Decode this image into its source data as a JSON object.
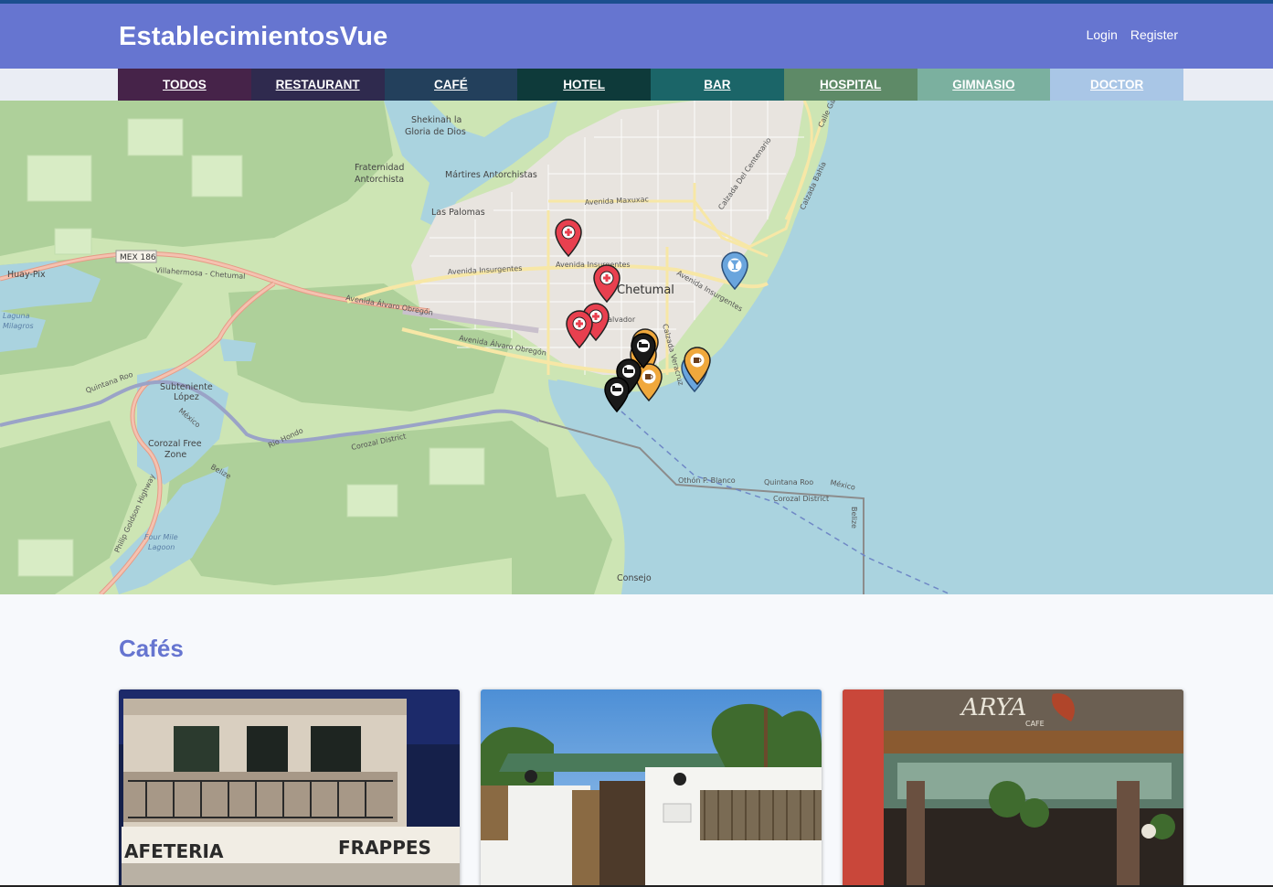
{
  "header": {
    "brand": "EstablecimientosVue",
    "login_label": "Login",
    "register_label": "Register",
    "bg_color": "#6675d0"
  },
  "nav": {
    "items": [
      {
        "label": "TODOS",
        "color": "#462349"
      },
      {
        "label": "RESTAURANT",
        "color": "#2f2a4e"
      },
      {
        "label": "CAFÉ",
        "color": "#23405c"
      },
      {
        "label": "HOTEL",
        "color": "#0e3a3a"
      },
      {
        "label": "BAR",
        "color": "#1b6568"
      },
      {
        "label": "HOSPITAL",
        "color": "#5e8a67"
      },
      {
        "label": "GIMNASIO",
        "color": "#7bb09f"
      },
      {
        "label": "DOCTOR",
        "color": "#a9c6e6"
      }
    ]
  },
  "map": {
    "labels": {
      "shekinah_1": "Shekinah la",
      "shekinah_2": "Gloria de Dios",
      "fraternidad_1": "Fraternidad",
      "fraternidad_2": "Antorchista",
      "martires": "Mártires Antorchistas",
      "palomas": "Las Palomas",
      "huay_pix": "Huay-Pix",
      "mex186": "MEX 186",
      "villahermosa": "Villahermosa - Chetumal",
      "av_maxuxac": "Avenida Maxuxac",
      "av_insurgentes": "Avenida Insurgentes",
      "av_insurgentes_e": "Avenida Insurgentes",
      "av_obregon": "Avenida Álvaro Obregón",
      "av_obregon_2": "Avenida Álvaro Obregón",
      "chetumal": "Chetumal",
      "salvador": "Salvador",
      "calzada_bahia": "Calzada Bahía",
      "calzada_cementerio": "Calzada Del Centenario",
      "calzada_veracruz": "Calzada Veracruz",
      "laguna_1": "Laguna",
      "laguna_2": "Milagros",
      "quintana_roo": "Quintana Roo",
      "subteniente_1": "Subteniente",
      "subteniente_2": "López",
      "corozal_1": "Corozal Free",
      "corozal_2": "Zone",
      "mexico": "México",
      "corozal_district": "Corozal District",
      "corozal_district_2": "Corozal District",
      "belize": "Belize",
      "belize_2": "Belize",
      "othon": "Othón P. Blanco",
      "quintana_roo_2": "Quintana Roo",
      "mexico_2": "México",
      "four_mile_1": "Four Mile",
      "four_mile_2": "Lagoon",
      "philip": "Philip Goldson Highway",
      "consejo": "Consejo",
      "rio_hondo": "Río Hondo",
      "calle_gaza": "Calle Gaza"
    },
    "markers": [
      {
        "type": "hospital",
        "color": "#e8404f",
        "icon": "cross-icon"
      },
      {
        "type": "hospital",
        "color": "#e8404f",
        "icon": "cross-icon"
      },
      {
        "type": "hospital",
        "color": "#e8404f",
        "icon": "cross-icon"
      },
      {
        "type": "hospital",
        "color": "#e8404f",
        "icon": "cross-icon"
      },
      {
        "type": "bar",
        "color": "#6aa5dd",
        "icon": "cocktail-icon"
      },
      {
        "type": "bar",
        "color": "#6aa5dd",
        "icon": "cocktail-icon"
      },
      {
        "type": "cafe",
        "color": "#f0a83c",
        "icon": "coffee-icon"
      },
      {
        "type": "cafe",
        "color": "#f0a83c",
        "icon": "coffee-icon"
      },
      {
        "type": "cafe",
        "color": "#f0a83c",
        "icon": "coffee-icon"
      },
      {
        "type": "cafe",
        "color": "#f0a83c",
        "icon": "coffee-icon"
      },
      {
        "type": "hotel",
        "color": "#1a1a1a",
        "icon": "bed-icon"
      },
      {
        "type": "hotel",
        "color": "#1a1a1a",
        "icon": "bed-icon"
      },
      {
        "type": "hotel",
        "color": "#1a1a1a",
        "icon": "bed-icon"
      }
    ]
  },
  "section": {
    "title": "Cafés"
  },
  "cards": [
    {
      "image_text_1": "AFETERIA",
      "image_text_2": "FRAPPES"
    },
    {},
    {
      "image_text_1": "ARYA",
      "image_text_2": "CAFE"
    }
  ]
}
